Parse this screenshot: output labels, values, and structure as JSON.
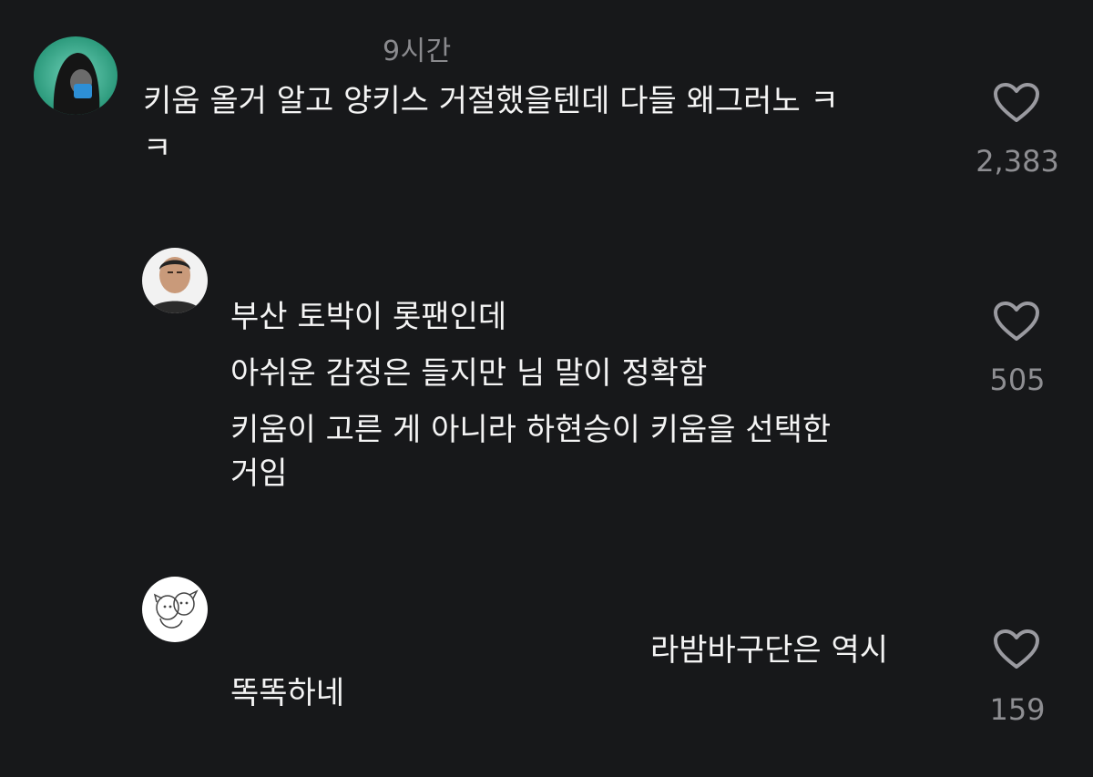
{
  "comments": [
    {
      "timestamp": "9시간",
      "avatar_icon": "masked-figure-avatar-icon",
      "lines": [
        "키움 올거 알고 양키스 거절했을텐데 다들 왜그러노 ㅋ",
        "ㅋ"
      ],
      "likes": "2,383"
    },
    {
      "avatar_icon": "man-portrait-avatar-icon",
      "lines": [
        "부산 토박이 롯팬인데",
        "아쉬운 감정은 들지만 님 말이 정확함",
        "키움이 고른 게 아니라 하현승이 키움을 선택한",
        "거임"
      ],
      "likes": "505"
    },
    {
      "avatar_icon": "drawn-puppies-avatar-icon",
      "lines": [
        "라밤바구단은 역시",
        "똑똑하네"
      ],
      "likes": "159"
    }
  ],
  "colors": {
    "background": "#17181a",
    "text": "#f4f4f4",
    "muted": "#8e8e92",
    "heart_outline": "#9a9aa0"
  },
  "icons": {
    "like": "heart-outline-icon"
  }
}
